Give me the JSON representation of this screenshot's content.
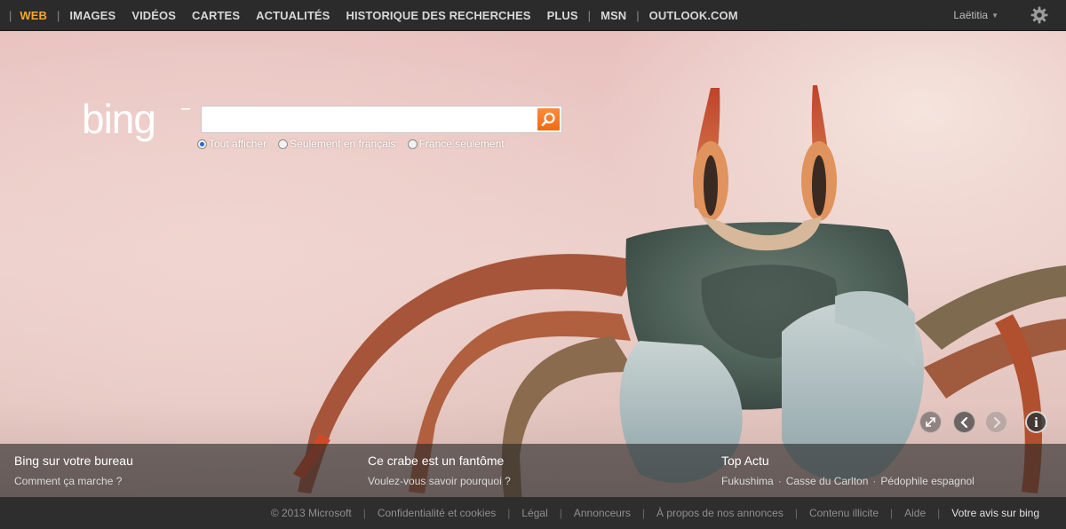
{
  "nav": {
    "items": [
      {
        "label": "WEB",
        "active": true
      },
      {
        "label": "IMAGES"
      },
      {
        "label": "VIDÉOS"
      },
      {
        "label": "CARTES"
      },
      {
        "label": "ACTUALITÉS"
      },
      {
        "label": "HISTORIQUE DES RECHERCHES"
      },
      {
        "label": "PLUS"
      },
      {
        "label": "MSN"
      },
      {
        "label": "OUTLOOK.COM"
      }
    ],
    "separator": "|",
    "user_name": "Laëtitia",
    "settings_icon": "gear-icon"
  },
  "search": {
    "logo_text": "bing",
    "input_value": "",
    "button_icon": "search-icon",
    "scope_options": [
      {
        "label": "Tout afficher",
        "checked": true
      },
      {
        "label": "Seulement en français",
        "checked": false
      },
      {
        "label": "France seulement",
        "checked": false
      }
    ]
  },
  "image_controls": {
    "expand_icon": "expand-icon",
    "prev_icon": "chevron-left-icon",
    "next_icon": "chevron-right-icon",
    "info_icon": "info-icon",
    "info_glyph": "i"
  },
  "info_band": {
    "col1": {
      "title": "Bing sur votre bureau",
      "sub": "Comment ça marche ?"
    },
    "col2": {
      "title": "Ce crabe est un fantôme",
      "sub": "Voulez-vous savoir pourquoi ?"
    },
    "col3": {
      "title": "Top Actu",
      "news": [
        "Fukushima",
        "Casse du Carlton",
        "Pédophile espagnol"
      ],
      "dot": "·"
    }
  },
  "footer": {
    "copyright": "© 2013 Microsoft",
    "links": [
      "Confidentialité et cookies",
      "Légal",
      "Annonceurs",
      "À propos de nos annonces",
      "Contenu illicite",
      "Aide"
    ],
    "feedback": "Votre avis sur bing",
    "separator": "|"
  },
  "colors": {
    "accent_active_nav": "#f7a823",
    "search_button": "#f06a10",
    "topbar_bg": "#2b2b2b"
  }
}
